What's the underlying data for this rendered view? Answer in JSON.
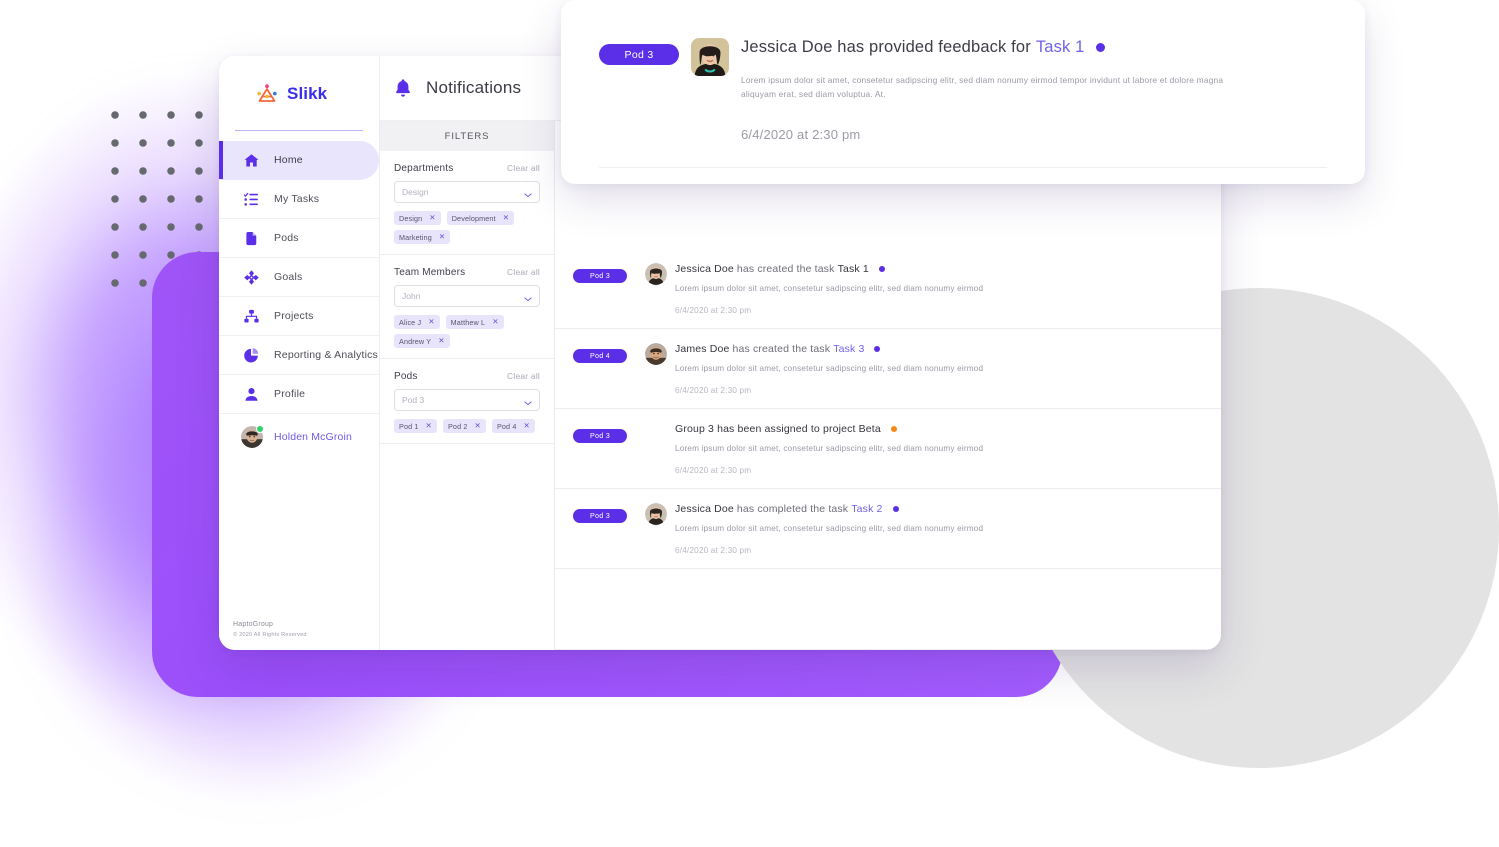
{
  "brand": {
    "name": "Slikk",
    "logo_icon": "slikk-logo-icon"
  },
  "sidebar": {
    "items": [
      {
        "label": "Home",
        "icon": "home-icon",
        "active": true
      },
      {
        "label": "My Tasks",
        "icon": "task-list-icon",
        "active": false
      },
      {
        "label": "Pods",
        "icon": "pods-icon",
        "active": false
      },
      {
        "label": "Goals",
        "icon": "goals-target-icon",
        "active": false
      },
      {
        "label": "Projects",
        "icon": "projects-hierarchy-icon",
        "active": false
      },
      {
        "label": "Reporting & Analytics",
        "icon": "pie-chart-icon",
        "active": false
      },
      {
        "label": "Profile",
        "icon": "person-icon",
        "active": false
      }
    ],
    "user": {
      "name": "Holden McGroin",
      "avatar_icon": "avatar-holden"
    },
    "footer": {
      "company": "HaptoGroup",
      "copyright": "© 2020 All Rights Reserved"
    }
  },
  "topbar": {
    "title": "Notifications",
    "bell_icon": "bell-icon"
  },
  "filters": {
    "header": "FILTERS",
    "clear_all_label": "Clear all",
    "groups": [
      {
        "title": "Departments",
        "select_value": "Design",
        "chips": [
          "Design",
          "Development",
          "Marketing"
        ]
      },
      {
        "title": "Team Members",
        "select_value": "John",
        "chips": [
          "Alice J",
          "Matthew L",
          "Andrew Y"
        ]
      },
      {
        "title": "Pods",
        "select_value": "Pod 3",
        "chips": [
          "Pod 1",
          "Pod 2",
          "Pod 4"
        ]
      }
    ]
  },
  "notifications": {
    "rows": [
      {
        "pod": "Pod 3",
        "has_avatar": true,
        "avatar_icon": "avatar-jessica",
        "actor": "Jessica Doe",
        "action": "has created the task",
        "target": "Task 1",
        "target_is_link": false,
        "dot_color": "#5b2ee8",
        "dot_style": "purple",
        "description": "Lorem ipsum dolor sit amet, consetetur sadipscing elitr, sed diam nonumy eirmod",
        "time": "6/4/2020 at 2:30 pm"
      },
      {
        "pod": "Pod 4",
        "has_avatar": true,
        "avatar_icon": "avatar-james",
        "actor": "James Doe",
        "action": "has created the task",
        "target": "Task 3",
        "target_is_link": true,
        "dot_color": "#5b2ee8",
        "dot_style": "purple",
        "description": "Lorem ipsum dolor sit amet, consetetur sadipscing elitr, sed diam nonumy eirmod",
        "time": "6/4/2020 at 2:30 pm"
      },
      {
        "pod": "Pod 3",
        "has_avatar": false,
        "avatar_icon": "",
        "actor": "Group 3",
        "action": "has been assigned to project Beta",
        "target": "",
        "target_is_link": false,
        "dot_color": "#f58a14",
        "dot_style": "orange",
        "description": "Lorem ipsum dolor sit amet, consetetur sadipscing elitr, sed diam nonumy eirmod",
        "time": "6/4/2020 at 2:30 pm"
      },
      {
        "pod": "Pod 3",
        "has_avatar": true,
        "avatar_icon": "avatar-jessica",
        "actor": "Jessica Doe",
        "action": "has completed the task",
        "target": "Task 2",
        "target_is_link": true,
        "dot_color": "#5b2ee8",
        "dot_style": "purple",
        "description": "Lorem ipsum dolor sit amet, consetetur sadipscing elitr, sed diam nonumy eirmod",
        "time": "6/4/2020 at 2:30 pm"
      }
    ]
  },
  "floating_card": {
    "pod": "Pod 3",
    "avatar_icon": "avatar-jessica",
    "actor": "Jessica Doe",
    "action": "has provided feedback for",
    "target": "Task 1",
    "dot_color": "#5b2ee8",
    "description": "Lorem ipsum dolor sit amet, consetetur sadipscing elitr, sed diam nonumy eirmod tempor invidunt ut labore et dolore magna aliquyam erat, sed diam voluptua. At.",
    "time": "6/4/2020 at 2:30 pm"
  },
  "colors": {
    "accent_purple": "#5b2ee8",
    "brand_blue": "#3b2df0",
    "chip_bg": "#e8e4fb",
    "status_orange": "#f58a14",
    "decor_purple_card": "#9f55f7",
    "decor_gray_circle": "#e3e3e3"
  }
}
